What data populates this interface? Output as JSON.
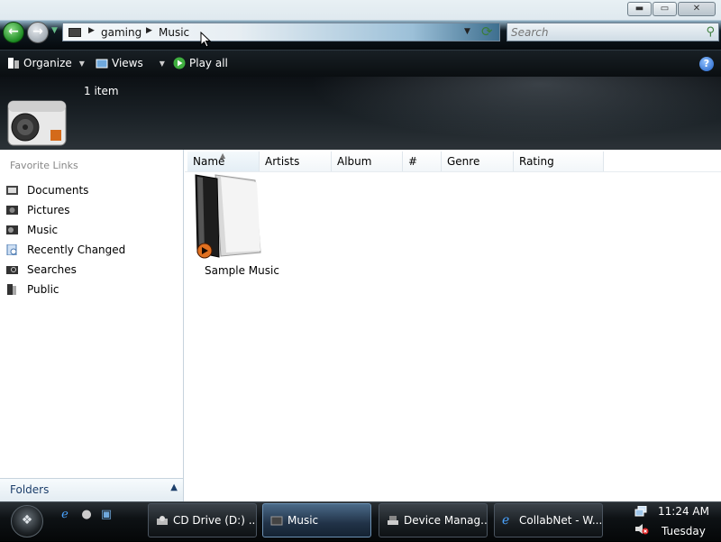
{
  "window": {
    "breadcrumb": [
      "gaming",
      "Music"
    ],
    "search_placeholder": "Search",
    "controls": {
      "minimize": "▬",
      "maximize": "▭",
      "close": "✕"
    }
  },
  "toolbar": {
    "organize_label": "Organize",
    "views_label": "Views",
    "play_all_label": "Play all",
    "help_label": "?"
  },
  "header": {
    "item_count": "1 item"
  },
  "navpane": {
    "title": "Favorite Links",
    "links": [
      {
        "label": "Documents",
        "icon": "documents-icon"
      },
      {
        "label": "Pictures",
        "icon": "pictures-icon"
      },
      {
        "label": "Music",
        "icon": "music-icon"
      },
      {
        "label": "Recently Changed",
        "icon": "recently-changed-icon"
      },
      {
        "label": "Searches",
        "icon": "searches-icon"
      },
      {
        "label": "Public",
        "icon": "public-icon"
      }
    ],
    "folders_label": "Folders"
  },
  "columns": [
    "Name",
    "Artists",
    "Album",
    "#",
    "Genre",
    "Rating"
  ],
  "files": [
    {
      "name": "Sample Music",
      "icon": "music-folder-icon"
    }
  ],
  "taskbar": {
    "tasks": [
      {
        "label": "CD Drive (D:) ...",
        "icon": "cd-drive-icon",
        "active": false
      },
      {
        "label": "Music",
        "icon": "folder-icon",
        "active": true
      },
      {
        "label": "Device Manag...",
        "icon": "device-manager-icon",
        "active": false
      },
      {
        "label": "CollabNet - W...",
        "icon": "internet-explorer-icon",
        "active": false
      }
    ],
    "time": "11:24 AM",
    "day": "Tuesday"
  },
  "colors": {
    "accent": "#1d3f6b",
    "toolbar_bg": "#0a0e11",
    "active_task": "#213247"
  }
}
